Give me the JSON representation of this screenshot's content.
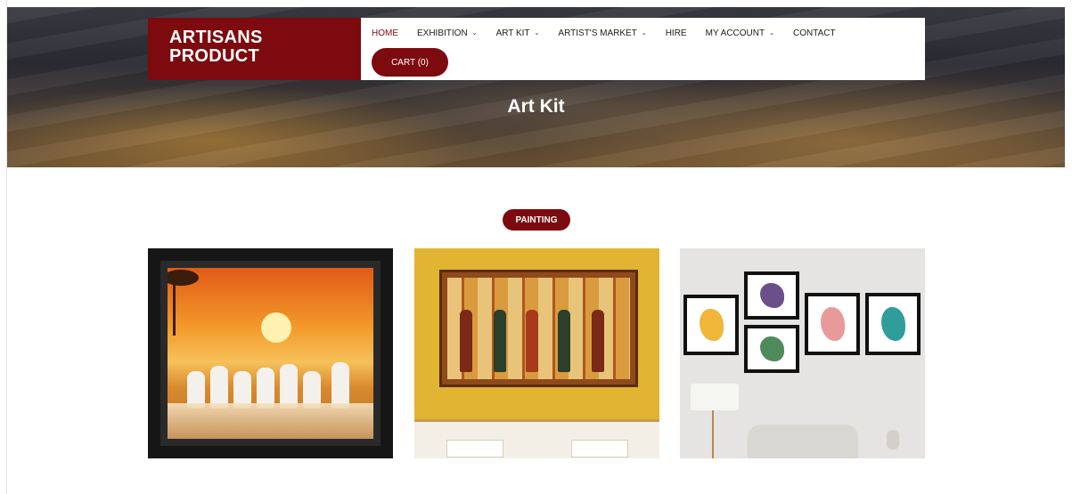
{
  "brand": {
    "line1": "ARTISANS",
    "line2": "PRODUCT",
    "color": "#7d0a0e"
  },
  "nav": {
    "items": [
      {
        "label": "HOME",
        "dropdown": false,
        "active": true
      },
      {
        "label": "EXHIBITION",
        "dropdown": true,
        "active": false
      },
      {
        "label": "ART KIT",
        "dropdown": true,
        "active": false
      },
      {
        "label": "ARTIST'S MARKET",
        "dropdown": true,
        "active": false
      },
      {
        "label": "HIRE",
        "dropdown": false,
        "active": false
      },
      {
        "label": "MY ACCOUNT",
        "dropdown": true,
        "active": false
      },
      {
        "label": "CONTACT",
        "dropdown": false,
        "active": false
      }
    ],
    "cart_label": "CART (0)"
  },
  "hero": {
    "title": "Art Kit"
  },
  "category": {
    "badge": "PAINTING"
  },
  "products": [
    {
      "image": "white-horses-sunset-painting"
    },
    {
      "image": "egyptian-mural-painting"
    },
    {
      "image": "framed-gallery-wall-prints"
    }
  ],
  "colors": {
    "accent": "#7d0a0e",
    "nav_text": "#1c1c1c",
    "background": "#ffffff"
  }
}
